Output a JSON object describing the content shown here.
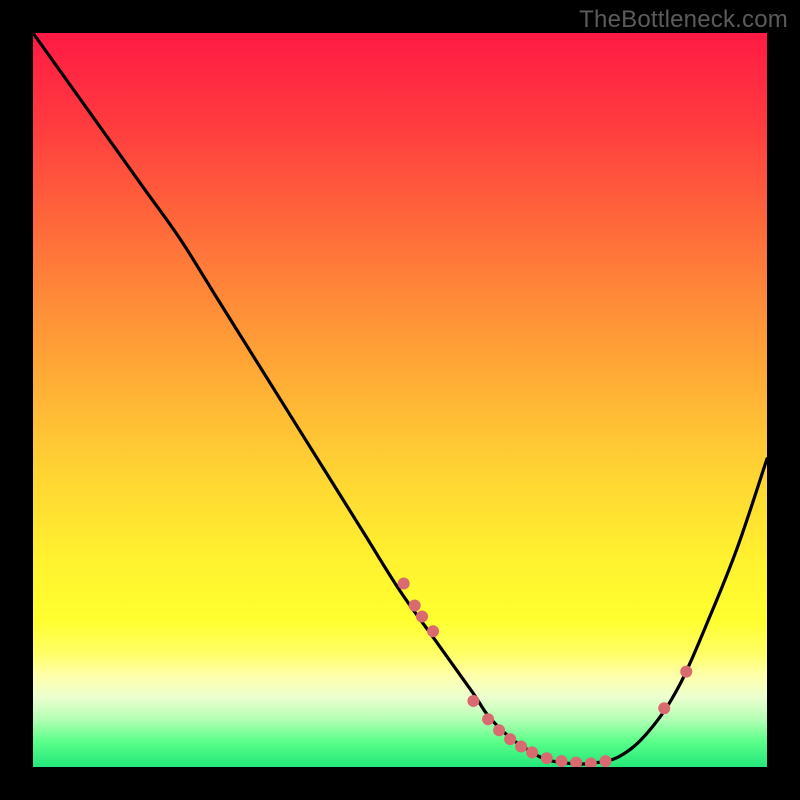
{
  "watermark": "TheBottleneck.com",
  "colors": {
    "background": "#000000",
    "curve": "#000000",
    "points": "#d96a6f",
    "gradient_stops": [
      {
        "offset": 0.0,
        "color": "#ff1a44"
      },
      {
        "offset": 0.12,
        "color": "#ff3a3f"
      },
      {
        "offset": 0.28,
        "color": "#ff6f3a"
      },
      {
        "offset": 0.45,
        "color": "#ffa636"
      },
      {
        "offset": 0.6,
        "color": "#ffd433"
      },
      {
        "offset": 0.72,
        "color": "#fff22f"
      },
      {
        "offset": 0.8,
        "color": "#ffff2f"
      },
      {
        "offset": 0.845,
        "color": "#ffff66"
      },
      {
        "offset": 0.875,
        "color": "#ffffaa"
      },
      {
        "offset": 0.905,
        "color": "#ecffd0"
      },
      {
        "offset": 0.935,
        "color": "#b4ffb4"
      },
      {
        "offset": 0.965,
        "color": "#5cff8a"
      },
      {
        "offset": 1.0,
        "color": "#22e878"
      }
    ]
  },
  "chart_data": {
    "type": "line",
    "title": "",
    "xlabel": "",
    "ylabel": "",
    "xlim": [
      0,
      100
    ],
    "ylim": [
      0,
      100
    ],
    "series": [
      {
        "name": "bottleneck-curve",
        "x": [
          0,
          5,
          10,
          15,
          20,
          25,
          30,
          35,
          40,
          45,
          50,
          55,
          60,
          62,
          65,
          68,
          70,
          73,
          76,
          80,
          84,
          88,
          92,
          96,
          100
        ],
        "y": [
          100,
          93,
          86,
          79,
          72,
          64,
          56,
          48,
          40,
          32,
          24,
          17,
          10,
          7,
          4,
          2,
          1,
          0.5,
          0.5,
          1.5,
          5,
          11,
          20,
          30,
          42
        ]
      }
    ],
    "points": {
      "name": "highlighted-points",
      "x": [
        50.5,
        52,
        53,
        54.5,
        60,
        62,
        63.5,
        65,
        66.5,
        68,
        70,
        72,
        74,
        76,
        78,
        86,
        89
      ],
      "y": [
        25,
        22,
        20.5,
        18.5,
        9,
        6.5,
        5,
        3.8,
        2.8,
        2,
        1.2,
        0.8,
        0.6,
        0.5,
        0.8,
        8,
        13
      ],
      "r": 6
    }
  }
}
